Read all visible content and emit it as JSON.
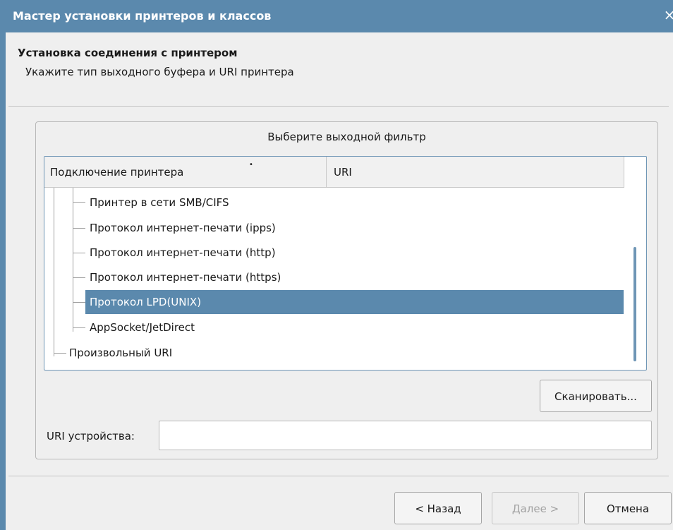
{
  "window": {
    "title": "Мастер установки принтеров и классов",
    "close_glyph": "×"
  },
  "header": {
    "title": "Установка соединения с принтером",
    "subtitle": "Укажите тип выходного буфера и URI принтера"
  },
  "group": {
    "title": "Выберите выходной фильтр"
  },
  "tree": {
    "columns": [
      "Подключение принтера",
      "URI"
    ],
    "sort_indicator": "•",
    "items": [
      {
        "label": "Принтер в сети SMB/CIFS",
        "selected": false
      },
      {
        "label": "Протокол интернет-печати (ipps)",
        "selected": false
      },
      {
        "label": "Протокол интернет-печати (http)",
        "selected": false
      },
      {
        "label": "Протокол интернет-печати (https)",
        "selected": false
      },
      {
        "label": "Протокол LPD(UNIX)",
        "selected": true
      },
      {
        "label": "AppSocket/JetDirect",
        "selected": false
      },
      {
        "label": "Произвольный URI",
        "selected": false
      }
    ]
  },
  "scan_button": "Сканировать...",
  "uri": {
    "label": "URI устройства:",
    "value": "",
    "placeholder": ""
  },
  "buttons": {
    "back": "< Назад",
    "next": "Далее >",
    "cancel": "Отмена"
  },
  "colors": {
    "accent": "#5b89ad",
    "background": "#efefef"
  }
}
